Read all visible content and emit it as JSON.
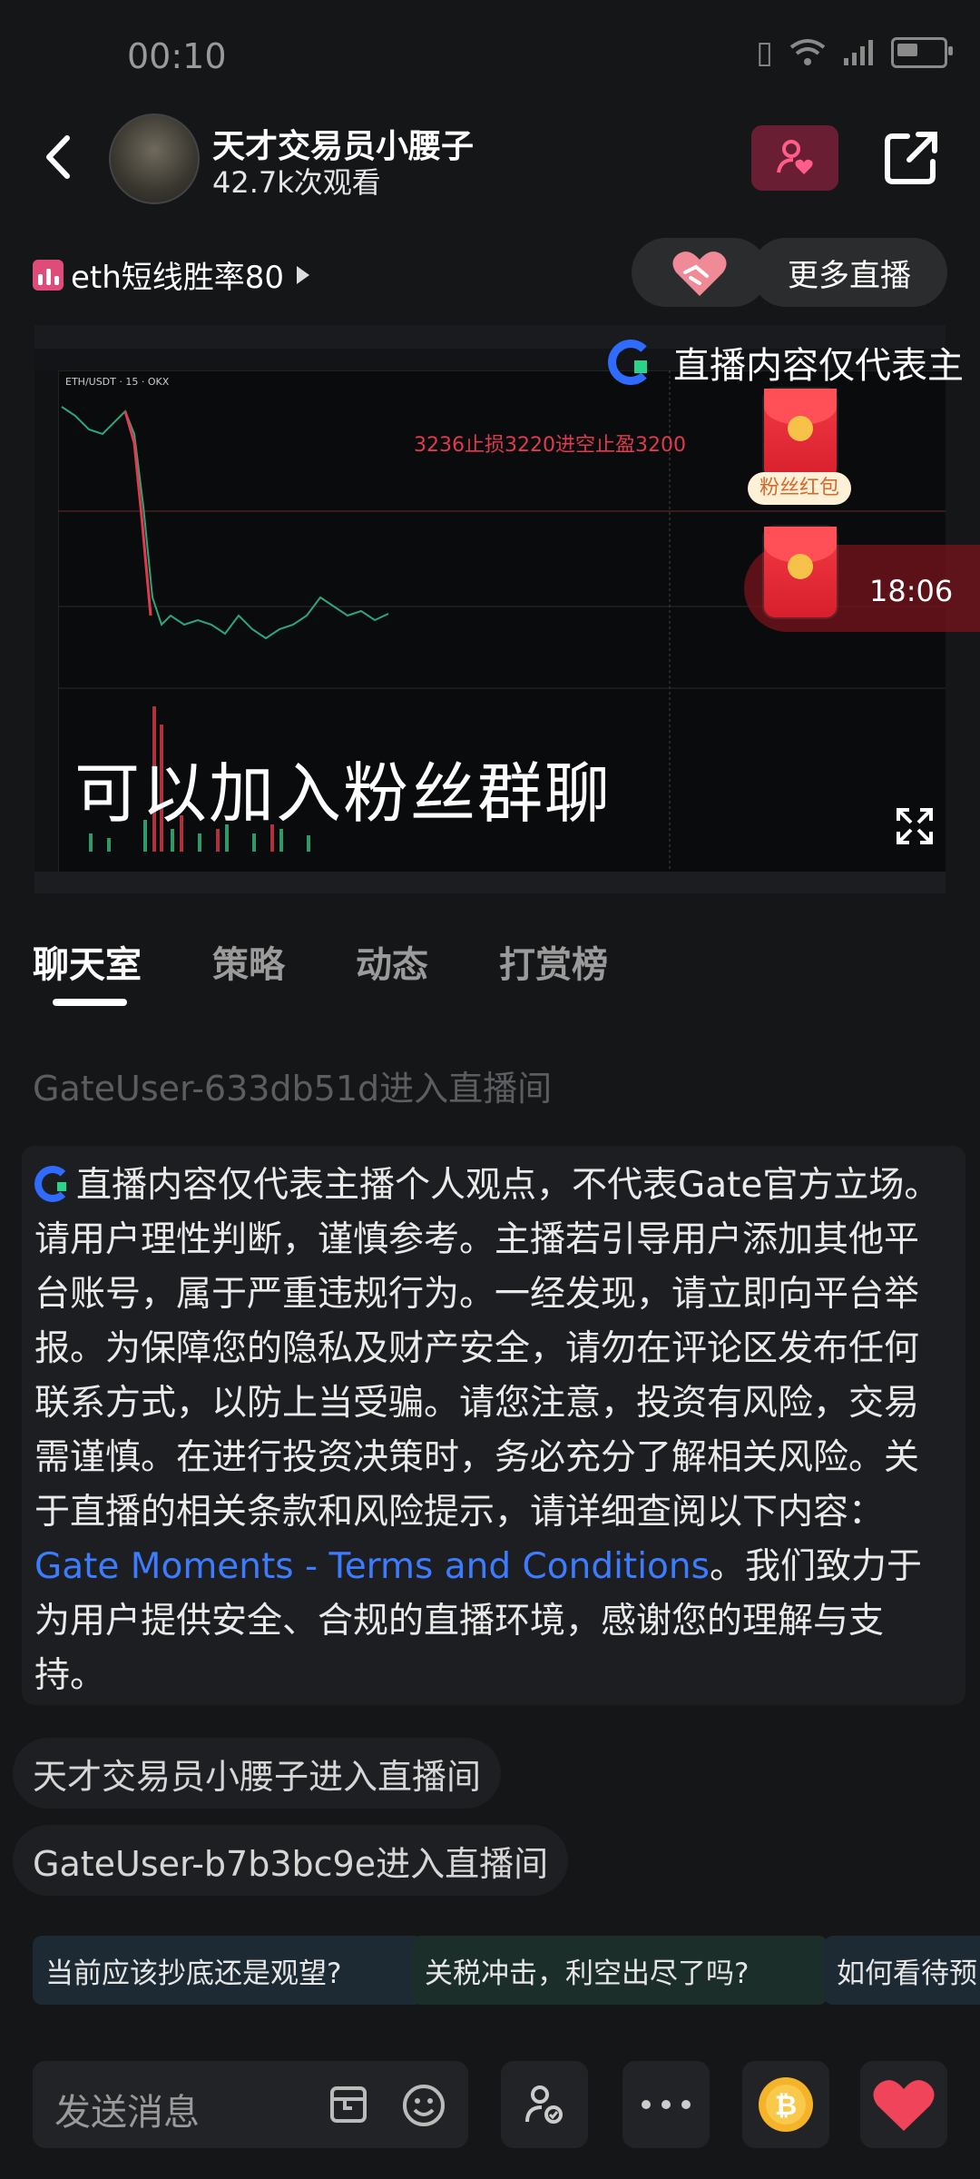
{
  "status_bar": {
    "time": "00:10"
  },
  "header": {
    "host_name": "天才交易员小腰子",
    "views": "42.7k次观看"
  },
  "live": {
    "title": "eth短线胜率80",
    "more_live_label": "更多直播"
  },
  "video": {
    "notice_overlay": "直播内容仅代表主",
    "trade_note": "3236止损3220进空止盈3200",
    "caption": "可以加入粉丝群聊",
    "red_packet_label": "粉丝红包",
    "timer": "18:06",
    "chart_symbol": "ETH/USDT · 15 · OKX"
  },
  "tabs": [
    {
      "label": "聊天室",
      "active": true
    },
    {
      "label": "策略",
      "active": false
    },
    {
      "label": "动态",
      "active": false
    },
    {
      "label": "打赏榜",
      "active": false
    }
  ],
  "chat": {
    "faded_entry": "GateUser-633db51d进入直播间",
    "notice_pre": "直播内容仅代表主播个人观点，不代表Gate官方立场。请用户理性判断，谨慎参考。主播若引导用户添加其他平台账号，属于严重违规行为。一经发现，请立即向平台举报。为保障您的隐私及财产安全，请勿在评论区发布任何联系方式，以防上当受骗。请您注意，投资有风险，交易需谨慎。在进行投资决策时，务必充分了解相关风险。关于直播的相关条款和风险提示，请详细查阅以下内容：",
    "notice_link": "Gate Moments - Terms and Conditions",
    "notice_post": "。我们致力于为用户提供安全、合规的直播环境，感谢您的理解与支持。",
    "entries": [
      "天才交易员小腰子进入直播间",
      "GateUser-b7b3bc9e进入直播间"
    ]
  },
  "quick_questions": [
    "当前应该抄底还是观望?",
    "关税冲击，利空出尽了吗?",
    "如何看待预"
  ],
  "input": {
    "placeholder": "发送消息"
  },
  "colors": {
    "accent": "#e04c7a",
    "link": "#3d7cff",
    "red": "#e03a4e"
  }
}
